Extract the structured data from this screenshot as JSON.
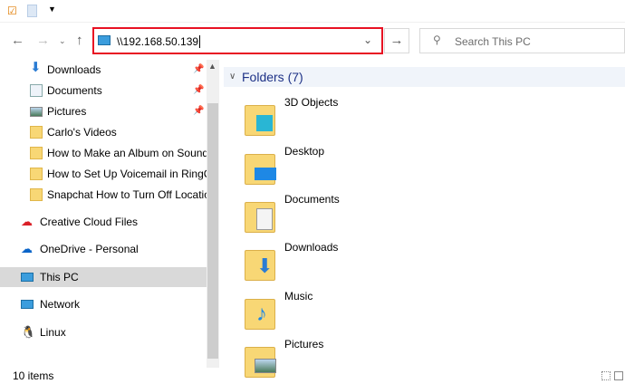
{
  "address": {
    "value": "\\\\192.168.50.139"
  },
  "search": {
    "placeholder": "Search This PC"
  },
  "sidebar": {
    "quick": [
      {
        "label": "Downloads",
        "pinned": true
      },
      {
        "label": "Documents",
        "pinned": true
      },
      {
        "label": "Pictures",
        "pinned": true
      },
      {
        "label": "Carlo's Videos"
      },
      {
        "label": "How to Make an Album on SoundC"
      },
      {
        "label": "How to Set Up Voicemail in RingCe"
      },
      {
        "label": "Snapchat How to Turn Off Location"
      }
    ],
    "roots": [
      {
        "label": "Creative Cloud Files"
      },
      {
        "label": "OneDrive - Personal"
      },
      {
        "label": "This PC"
      },
      {
        "label": "Network"
      },
      {
        "label": "Linux"
      }
    ]
  },
  "main": {
    "group_title": "Folders (7)",
    "folders": [
      "3D Objects",
      "Desktop",
      "Documents",
      "Downloads",
      "Music",
      "Pictures"
    ]
  },
  "status": {
    "count": "10 items"
  }
}
